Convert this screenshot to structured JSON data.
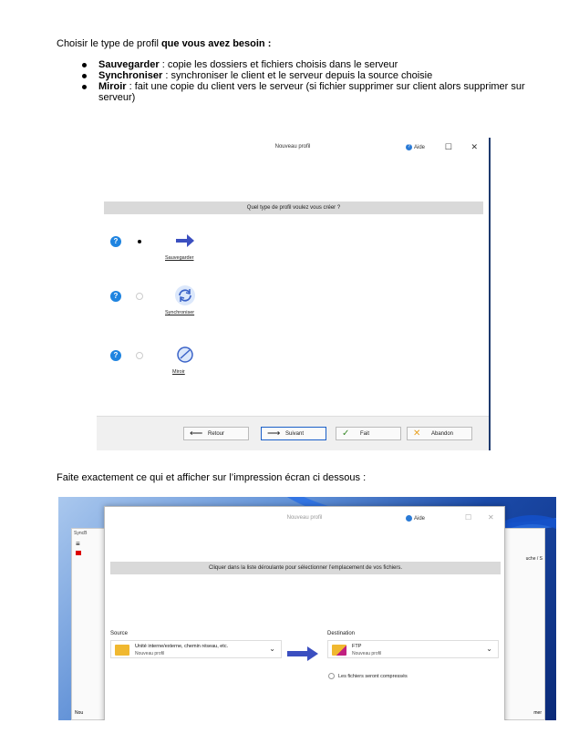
{
  "intro": {
    "text_plain": "Choisir le type de profil ",
    "text_bold": "que vous avez besoin  :"
  },
  "bullets": [
    {
      "term": "Sauvegarder",
      "desc": " : copie les dossiers et fichiers choisis dans le serveur"
    },
    {
      "term": "Synchroniser",
      "desc": " : synchroniser le client et le serveur depuis la source choisie"
    },
    {
      "term": "Miroir",
      "desc": " : fait une copie du client vers le serveur (si fichier supprimer sur client alors supprimer sur serveur)"
    }
  ],
  "dialog1": {
    "title": "Nouveau profil",
    "aide": "Aide",
    "question": "Quel type de profil voulez vous créer ?",
    "options": [
      {
        "label": "Sauvegarder",
        "selected": true,
        "icon": "arrow-right-icon"
      },
      {
        "label": "Synchroniser",
        "selected": false,
        "icon": "sync-icon"
      },
      {
        "label": "Miroir",
        "selected": false,
        "icon": "mirror-icon"
      }
    ],
    "buttons": {
      "retour": "Retour",
      "suivant": "Suivant",
      "fait": "Fait",
      "abandon": "Abandon"
    }
  },
  "middle_text": "Faite exactement ce qui et afficher sur l’impression écran ci dessous :",
  "dialog2": {
    "title": "Nouveau profil",
    "aide": "Aide",
    "back_window_title": "SyncB",
    "back_window_right": "uche / S",
    "bottom_left": "Nou",
    "bottom_right": "mer",
    "instruction": "Cliquer dans la liste déroulante pour sélectionner l’emplacement de vos fichiers.",
    "source": {
      "label": "Source",
      "line1": "Unité interne/externe, chemin réseau, etc.",
      "line2": "Nouveau profil"
    },
    "destination": {
      "label": "Destination",
      "line1": "FTP",
      "line2": "Nouveau profil"
    },
    "compress_label": "Les fichiers seront compressés"
  }
}
